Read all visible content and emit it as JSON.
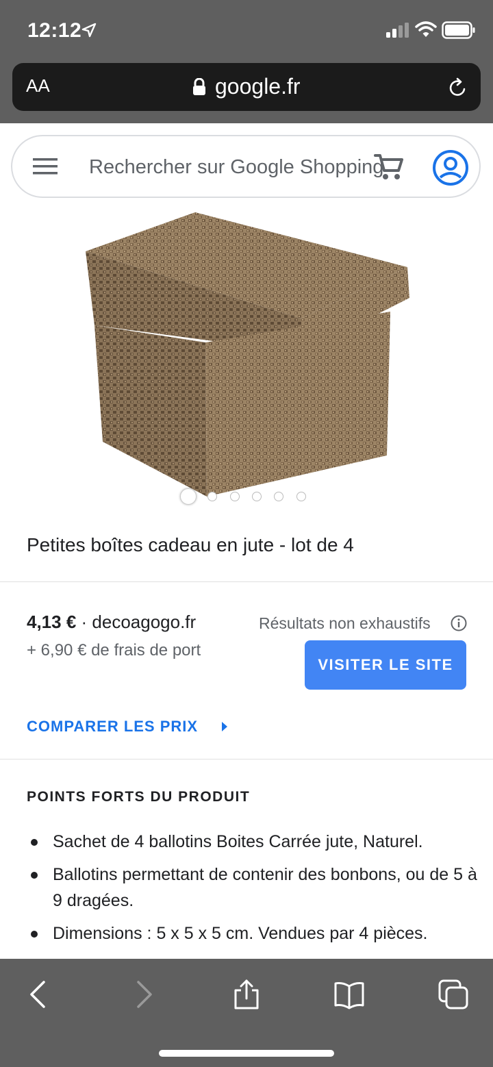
{
  "status_bar": {
    "time": "12:12"
  },
  "browser": {
    "text_size_label": "AA",
    "domain": "google.fr"
  },
  "search": {
    "placeholder": "Rechercher sur Google Shopping"
  },
  "product": {
    "image_alt": "product-image",
    "carousel": {
      "total": 6,
      "active_index": 0
    },
    "title": "Petites boîtes cadeau en jute - lot de 4"
  },
  "offer": {
    "price": "4,13 €",
    "separator": " · ",
    "seller": "decoagogo.fr",
    "shipping": "+ 6,90 € de frais de port",
    "results_note": "Résultats non exhaustifs",
    "visit_button": "VISITER LE SITE",
    "compare_link": "COMPARER LES PRIX"
  },
  "highlights": {
    "title": "POINTS FORTS DU PRODUIT",
    "items": [
      "Sachet de 4 ballotins Boites Carrée jute, Naturel.",
      "Ballotins permettant de contenir des bonbons, ou de 5 à 9 dragées.",
      "Dimensions : 5 x 5 x 5 cm. Vendues par 4 pièces."
    ]
  },
  "toolbar": {
    "icons": [
      "back-icon",
      "forward-icon",
      "share-icon",
      "bookmarks-icon",
      "tabs-icon"
    ]
  },
  "colors": {
    "accent_blue": "#4285f4",
    "link_blue": "#1a73e8",
    "chrome_gray": "#5f5f5f"
  }
}
